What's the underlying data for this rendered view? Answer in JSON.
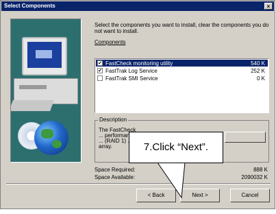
{
  "window": {
    "title": "Select Components",
    "close_glyph": "×"
  },
  "instructions": "Select the components you want to install, clear the components you do not want to install.",
  "components": {
    "label": "Components",
    "items": [
      {
        "name": "FastCheck monitoring utility",
        "size": "540 K",
        "checked": true,
        "selected": true
      },
      {
        "name": "FastTrak Log Service",
        "size": "252 K",
        "checked": true,
        "selected": false
      },
      {
        "name": "FastTrak SMI Service",
        "size": "0 K",
        "checked": false,
        "selected": false
      }
    ]
  },
  "description": {
    "legend": "Description",
    "text": "The FastCheck ... performance ... (RAID 1) ... array.",
    "button_label": ""
  },
  "space": {
    "required_label": "Space Required:",
    "required_value": "888 K",
    "available_label": "Space Available:",
    "available_value": "2090032 K"
  },
  "buttons": {
    "back": "< Back",
    "next": "Next >",
    "cancel": "Cancel"
  },
  "callout": {
    "text": "7.Click “Next”."
  },
  "colors": {
    "dialog_bg": "#d4d0c8",
    "title_bg": "#0a246a",
    "selection": "#0a246a"
  },
  "icons": {
    "monitor_art": "computer-illustration-icon",
    "globe_art": "globe-icon"
  }
}
